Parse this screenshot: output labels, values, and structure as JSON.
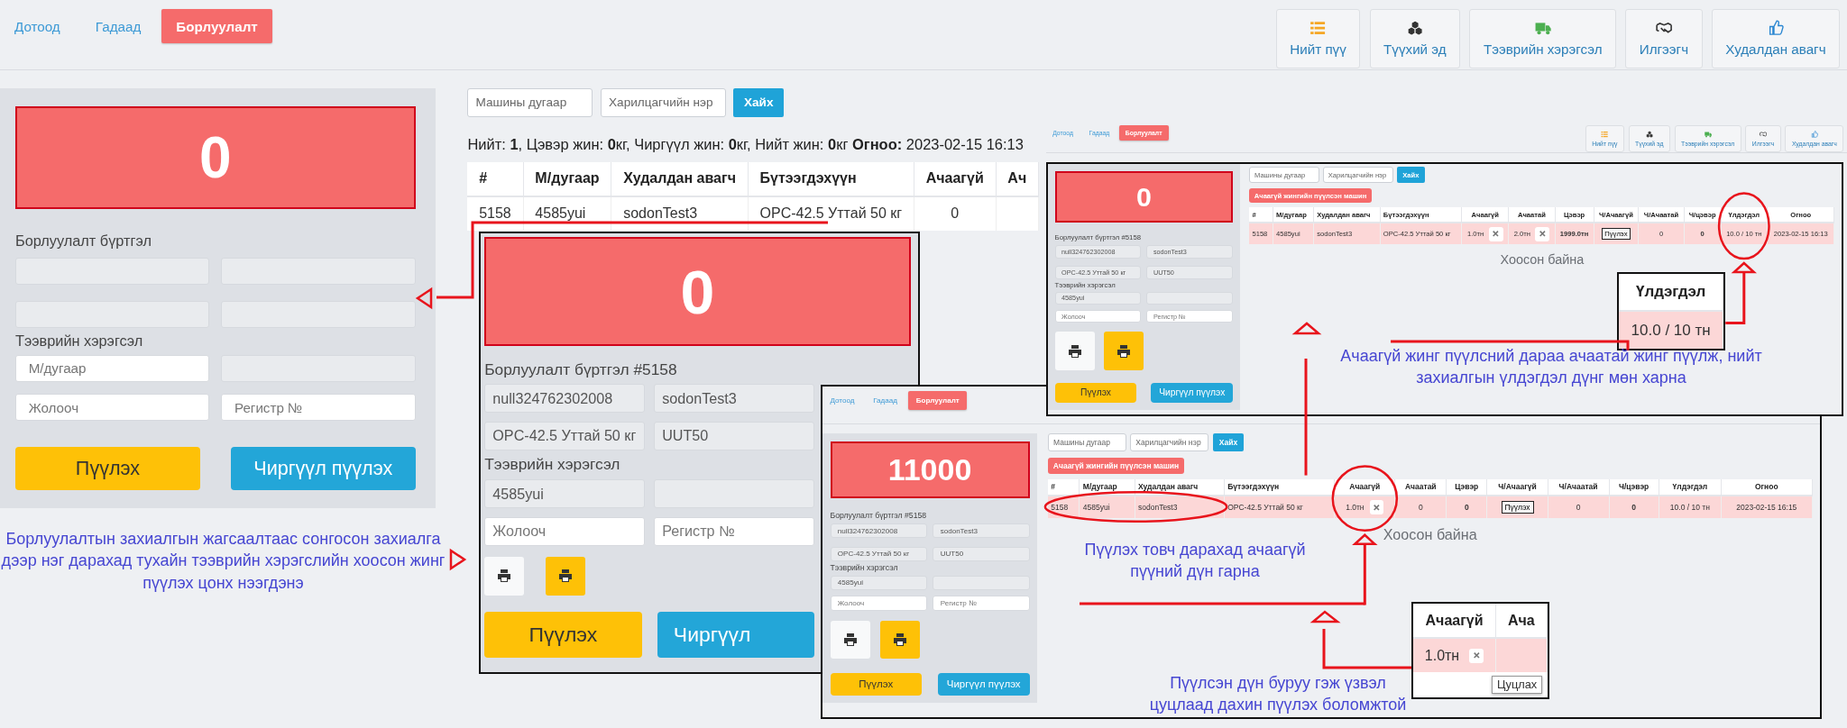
{
  "header": {
    "tabs": [
      {
        "label": "Дотоод",
        "selected": false
      },
      {
        "label": "Гадаад",
        "selected": false
      },
      {
        "label": "Борлуулалт",
        "selected": true
      }
    ],
    "toolbar": [
      {
        "label": "Нийт пүү"
      },
      {
        "label": "Түүхий эд"
      },
      {
        "label": "Тээврийн хэрэгсэл"
      },
      {
        "label": "Илгээгч"
      },
      {
        "label": "Худалдан авагч"
      }
    ]
  },
  "panel": {
    "display": "0",
    "title": "Борлуулалт бүртгэл",
    "order_fields": [
      {
        "readonly": true
      },
      {
        "readonly": true
      },
      {
        "readonly": true
      },
      {
        "readonly": true
      }
    ],
    "section": "Тээврийн хэрэгсэл",
    "vehicle_fields": [
      {
        "placeholder": "М/дугаар",
        "readonly": false
      },
      {
        "readonly": true
      },
      {
        "placeholder": "Жолооч",
        "readonly": false
      },
      {
        "placeholder": "Регистр №",
        "readonly": false
      }
    ],
    "actions": [
      {
        "label": "Пүүлэх",
        "kind": "warning"
      },
      {
        "label": "Чиргүүл пүүлэх",
        "kind": "info"
      }
    ]
  },
  "search": {
    "fields": [
      {
        "placeholder": "Машины дугаар"
      },
      {
        "placeholder": "Харилцагчийн нэр"
      }
    ],
    "button": "Хайх"
  },
  "summary": "Нийт: **1**, Цэвэр жин: **0**кг, Чиргүүл жин: **0**кг, Нийт жин: **0**кг **Огноо:** 2023-02-15 16:13",
  "table": {
    "columns": [
      "#",
      "М/дугаар",
      "Худалдан авагч",
      "Бүтээгдэхүүн",
      "Ачаагүй",
      "Ач"
    ],
    "rows": [
      {
        "highlighted": false,
        "cells": [
          {
            "kind": "text",
            "text": "5158"
          },
          {
            "kind": "text",
            "text": "4585yui"
          },
          {
            "kind": "text",
            "text": "sodonTest3"
          },
          {
            "kind": "text",
            "text": "OPC-42.5 Уттай 50 кг"
          },
          {
            "kind": "text",
            "text": "0"
          }
        ]
      }
    ]
  },
  "insets": [
    {
      "kind": "panel",
      "panel": {
        "display": "0",
        "title": "Борлуулалт бүртгэл #5158",
        "order_fields": [
          {
            "value": "null324762302008",
            "readonly": true
          },
          {
            "value": "sodonTest3",
            "readonly": true
          },
          {
            "value": "OPC-42.5 Уттай 50 кг",
            "readonly": true
          },
          {
            "value": "UUT50",
            "readonly": true
          }
        ],
        "section": "Тээврийн хэрэгсэл",
        "vehicle_fields": [
          {
            "value": "4585yui",
            "readonly": true
          },
          {
            "readonly": true
          },
          {
            "placeholder": "Жолооч",
            "readonly": false
          },
          {
            "placeholder": "Регистр №",
            "readonly": false
          }
        ],
        "print_buttons": [
          {
            "kind": "light"
          },
          {
            "kind": "warning"
          }
        ],
        "actions": [
          {
            "label": "Пүүлэх",
            "kind": "warning"
          },
          {
            "label": "Чиргүүл",
            "kind": "info"
          }
        ]
      }
    },
    {
      "kind": "screen",
      "header": {
        "tabs": [
          {
            "label": "Дотоод",
            "selected": false
          },
          {
            "label": "Гадаад",
            "selected": false
          },
          {
            "label": "Борлуулалт",
            "selected": true
          }
        ]
      },
      "panel": {
        "display": "11000",
        "title": "Борлуулалт бүртгэл #5158",
        "order_fields": [
          {
            "value": "null324762302008",
            "readonly": true
          },
          {
            "value": "sodonTest3",
            "readonly": true
          },
          {
            "value": "OPC-42.5 Уттай 50 кг",
            "readonly": true
          },
          {
            "value": "UUT50",
            "readonly": true
          }
        ],
        "section": "Тээврийн хэрэгсэл",
        "vehicle_fields": [
          {
            "value": "4585yui",
            "readonly": true
          },
          {
            "readonly": true
          },
          {
            "placeholder": "Жолооч",
            "readonly": false
          },
          {
            "placeholder": "Регистр №",
            "readonly": false
          }
        ],
        "print_buttons": [
          {
            "kind": "light"
          },
          {
            "kind": "warning"
          }
        ],
        "actions": [
          {
            "label": "Пүүлэх",
            "kind": "warning"
          },
          {
            "label": "Чиргүүл пүүлэх",
            "kind": "info"
          }
        ]
      },
      "search": {
        "fields": [
          {
            "placeholder": "Машины дугаар"
          },
          {
            "placeholder": "Харилцагчийн нэр"
          }
        ],
        "button": "Хайх"
      },
      "alert_button": "Ачаагүй жингийн пүүлсэн машин",
      "table": {
        "columns": [
          "#",
          "М/дугаар",
          "Худалдан авагч",
          "Бүтээгдэхүүн",
          "Ачаагүй",
          "Ачаатай",
          "Цэвэр",
          "Ч/Ачаагүй",
          "Ч/Ачаатай",
          "Ч/цэвэр",
          "Үлдэгдэл",
          "Огноо"
        ],
        "rows": [
          {
            "highlighted": true,
            "cells": [
              {
                "kind": "text",
                "text": "5158"
              },
              {
                "kind": "text",
                "text": "4585yui"
              },
              {
                "kind": "text",
                "text": "sodonTest3"
              },
              {
                "kind": "text",
                "text": "OPC-42.5 Уттай 50 кг"
              },
              {
                "kind": "weight",
                "text": "1.0тн"
              },
              {
                "kind": "text",
                "text": "0"
              },
              {
                "kind": "bold",
                "text": "0"
              },
              {
                "kind": "button",
                "text": "Пүүлэх"
              },
              {
                "kind": "text",
                "text": "0"
              },
              {
                "kind": "bold",
                "text": "0"
              },
              {
                "kind": "text",
                "text": "10.0 / 10 тн"
              },
              {
                "kind": "text",
                "text": "2023-02-15 16:15"
              }
            ]
          }
        ]
      },
      "empty_text": "Хоосон байна"
    },
    {
      "kind": "header",
      "header": {
        "tabs": [
          {
            "label": "Дотоод",
            "selected": false
          },
          {
            "label": "Гадаад",
            "selected": false
          },
          {
            "label": "Борлуулалт",
            "selected": true
          }
        ],
        "toolbar": [
          {
            "label": "Нийт пүү"
          },
          {
            "label": "Түүхий эд"
          },
          {
            "label": "Тээврийн хэрэгсэл"
          },
          {
            "label": "Илгээгч"
          },
          {
            "label": "Худалдан авагч"
          }
        ]
      }
    },
    {
      "kind": "screen",
      "panel": {
        "display": "0",
        "title": "Борлуулалт бүртгэл #5158",
        "order_fields": [
          {
            "value": "null324762302008",
            "readonly": true
          },
          {
            "value": "sodonTest3",
            "readonly": true
          },
          {
            "value": "OPC-42.5 Уттай 50 кг",
            "readonly": true
          },
          {
            "value": "UUT50",
            "readonly": true
          }
        ],
        "section": "Тээврийн хэрэгсэл",
        "vehicle_fields": [
          {
            "value": "4585yui",
            "readonly": true
          },
          {
            "readonly": true
          },
          {
            "placeholder": "Жолооч",
            "readonly": false
          },
          {
            "placeholder": "Регистр №",
            "readonly": false
          }
        ],
        "print_buttons": [
          {
            "kind": "light"
          },
          {
            "kind": "warning"
          }
        ],
        "actions": [
          {
            "label": "Пүүлэх",
            "kind": "warning"
          },
          {
            "label": "Чиргүүл пүүлэх",
            "kind": "info"
          }
        ]
      },
      "search": {
        "fields": [
          {
            "placeholder": "Машины дугаар"
          },
          {
            "placeholder": "Харилцагчийн нэр"
          }
        ],
        "button": "Хайх"
      },
      "alert_button": "Ачаагүй жингийн пүүлсэн машин",
      "table": {
        "columns": [
          "#",
          "М/дугаар",
          "Худалдан авагч",
          "Бүтээгдэхүүн",
          "Ачаагүй",
          "Ачаатай",
          "Цэвэр",
          "Ч/Ачаагүй",
          "Ч/Ачаатай",
          "Ч/цэвэр",
          "Үлдэгдэл",
          "Огноо"
        ],
        "rows": [
          {
            "highlighted": true,
            "cells": [
              {
                "kind": "text",
                "text": "5158"
              },
              {
                "kind": "text",
                "text": "4585yui"
              },
              {
                "kind": "text",
                "text": "sodonTest3"
              },
              {
                "kind": "text",
                "text": "OPC-42.5 Уттай 50 кг"
              },
              {
                "kind": "weight",
                "text": "1.0тн"
              },
              {
                "kind": "weight",
                "text": "2.0тн"
              },
              {
                "kind": "bold",
                "text": "1999.0тн"
              },
              {
                "kind": "button",
                "text": "Пүүлэх"
              },
              {
                "kind": "text",
                "text": "0"
              },
              {
                "kind": "bold",
                "text": "0"
              },
              {
                "kind": "text",
                "text": "10.0 / 10 тн"
              },
              {
                "kind": "text",
                "text": "2023-02-15 16:13"
              }
            ]
          }
        ]
      },
      "empty_text": "Хоосон байна"
    }
  ],
  "callouts": [
    {
      "columns": [
        "Үлдэгдэл"
      ],
      "rows": [
        {
          "highlighted": true,
          "cells": [
            {
              "kind": "text",
              "text": "10.0 / 10 тн"
            }
          ]
        }
      ]
    },
    {
      "columns": [
        "Ачаагүй",
        "Ача"
      ],
      "rows": [
        {
          "highlighted": true,
          "cells": [
            {
              "kind": "weight",
              "text": "1.0тн"
            }
          ]
        }
      ],
      "tooltip": "Цуцлах"
    }
  ],
  "annotations": [
    "Борлуулалтын захиалгын жагсаалтаас сонгосон захиалга дээр нэг дарахад тухайн тээврийн хэрэгслийн хоосон жинг пүүлэх цонх нээгдэнэ",
    "Ачаагүй жинг пүүлсний дараа ачаатай жинг пүүлж, нийт захиалгын үлдэгдэл дүнг мөн харна",
    "Пүүлэх товч дарахад ачаагүй пүүний дүн гарна",
    "Пүүлсэн дүн буруу гэж үзвэл цуцлаад дахин пүүлэх боломжтой"
  ]
}
